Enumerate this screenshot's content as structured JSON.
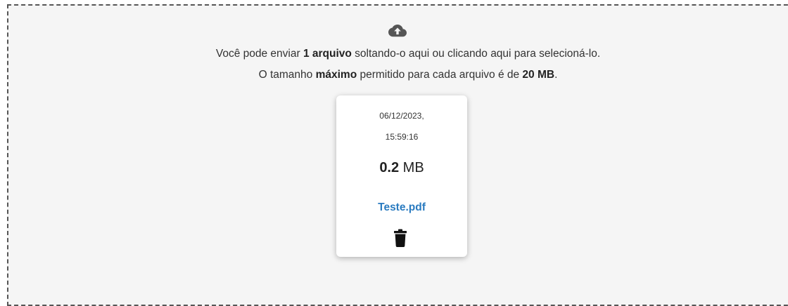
{
  "dropzone": {
    "line1_part1": "Você pode enviar ",
    "line1_bold1": "1 arquivo",
    "line1_part2": " soltando-o aqui ou clicando aqui para selecioná-lo.",
    "line2_part1": "O tamanho ",
    "line2_bold1": "máximo",
    "line2_part2": " permitido para cada arquivo é de ",
    "line2_bold2": "20 MB",
    "line2_part3": ".",
    "upload_icon": "cloud-upload-icon"
  },
  "file": {
    "date": "06/12/2023,",
    "time": "15:59:16",
    "size_value": "0.2",
    "size_unit": " MB",
    "name": "Teste.pdf",
    "delete_icon": "trash-icon"
  },
  "colors": {
    "link": "#2a7bc0",
    "dropzone_bg": "#f5f5f5",
    "border": "#555555"
  }
}
